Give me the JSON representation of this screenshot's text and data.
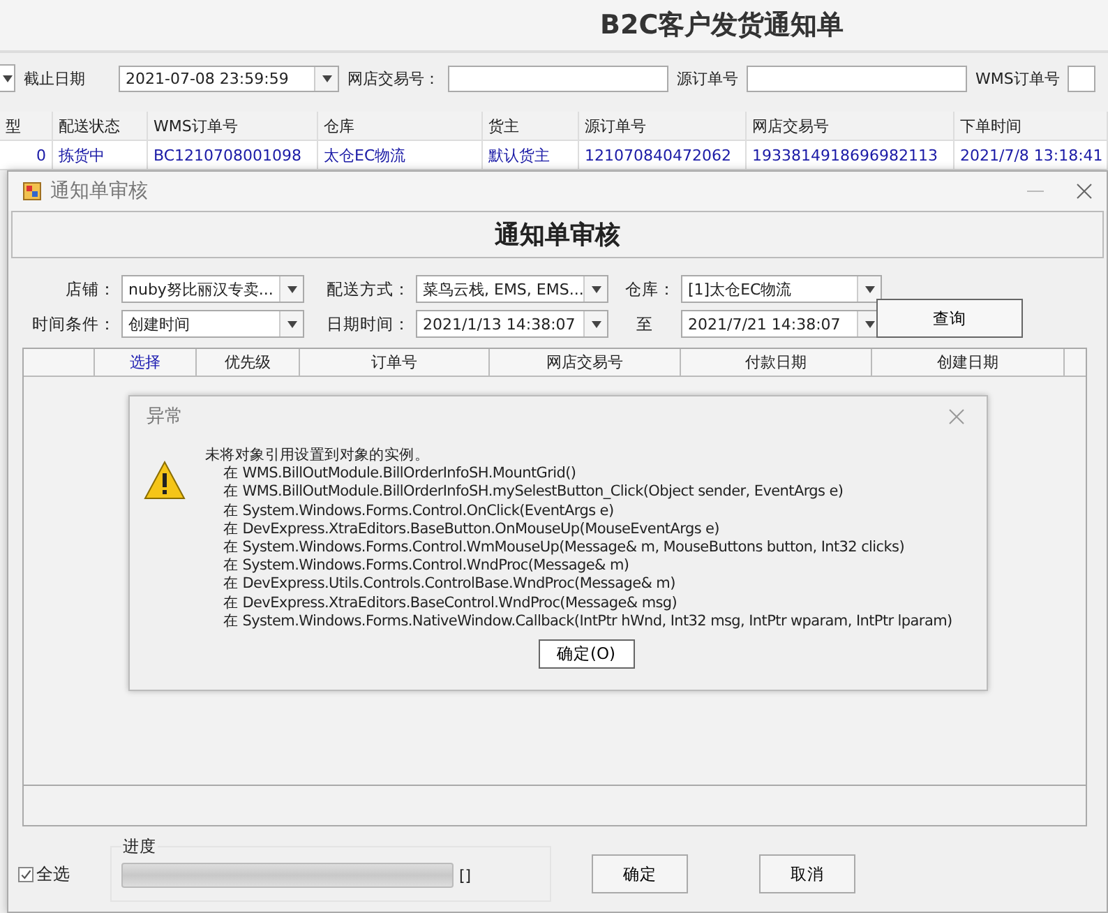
{
  "page_title": "B2C客户发货通知单",
  "filters": [
    {
      "kind": "date",
      "label": "截止日期",
      "value": "2021-07-08 23:59:59"
    },
    {
      "kind": "text",
      "label": "网店交易号："
    },
    {
      "kind": "text",
      "label": "源订单号"
    },
    {
      "kind": "text",
      "label": "WMS订单号"
    }
  ],
  "orders_table": {
    "columns": [
      "型",
      "配送状态",
      "WMS订单号",
      "仓库",
      "货主",
      "源订单号",
      "网店交易号",
      "下单时间"
    ],
    "rows": [
      {
        "cells": [
          "0",
          "拣货中",
          "BC1210708001098",
          "太仓EC物流",
          "默认货主",
          "121070840472062",
          "1933814918696982113",
          "2021/7/8 13:18:41"
        ]
      }
    ]
  },
  "audit_window": {
    "title": "通知单审核",
    "heading": "通知单审核",
    "filters": [
      {
        "label": "店铺：",
        "value": "nuby努比丽汉专卖..."
      },
      {
        "label": "配送方式：",
        "value": "菜鸟云栈, EMS, EMS..."
      },
      {
        "label": "仓库：",
        "value": "[1]太仓EC物流"
      },
      {
        "label": "时间条件：",
        "value": "创建时间"
      },
      {
        "label": "日期时间：",
        "value": "2021/1/13 14:38:07"
      },
      {
        "label": "至",
        "value": "2021/7/21 14:38:07"
      }
    ],
    "query_button": "查询",
    "grid": {
      "columns": [
        {
          "label": "选择",
          "highlighted": true
        },
        {
          "label": "优先级",
          "highlighted": false
        },
        {
          "label": "订单号",
          "highlighted": false
        },
        {
          "label": "网店交易号",
          "highlighted": false
        },
        {
          "label": "付款日期",
          "highlighted": false
        },
        {
          "label": "创建日期",
          "highlighted": false
        }
      ]
    },
    "select_all": {
      "label": "全选",
      "checked": true
    },
    "progress": {
      "label": "进度",
      "level": 0,
      "reading": "[]"
    },
    "buttons": [
      "确定",
      "取消"
    ]
  },
  "error_dialog": {
    "title": "异常",
    "message": "未将对象引用设置到对象的实例。",
    "stack": [
      "在 WMS.BillOutModule.BillOrderInfoSH.MountGrid()",
      "在 WMS.BillOutModule.BillOrderInfoSH.mySelestButton_Click(Object sender, EventArgs e)",
      "在 System.Windows.Forms.Control.OnClick(EventArgs e)",
      "在 DevExpress.XtraEditors.BaseButton.OnMouseUp(MouseEventArgs e)",
      "在 System.Windows.Forms.Control.WmMouseUp(Message& m, MouseButtons button, Int32 clicks)",
      "在 System.Windows.Forms.Control.WndProc(Message& m)",
      "在 DevExpress.Utils.Controls.ControlBase.WndProc(Message& m)",
      "在 DevExpress.XtraEditors.BaseControl.WndProc(Message& msg)",
      "在 System.Windows.Forms.NativeWindow.Callback(IntPtr hWnd, Int32 msg, IntPtr wparam, IntPtr lparam)"
    ],
    "button": "确定(O)"
  }
}
